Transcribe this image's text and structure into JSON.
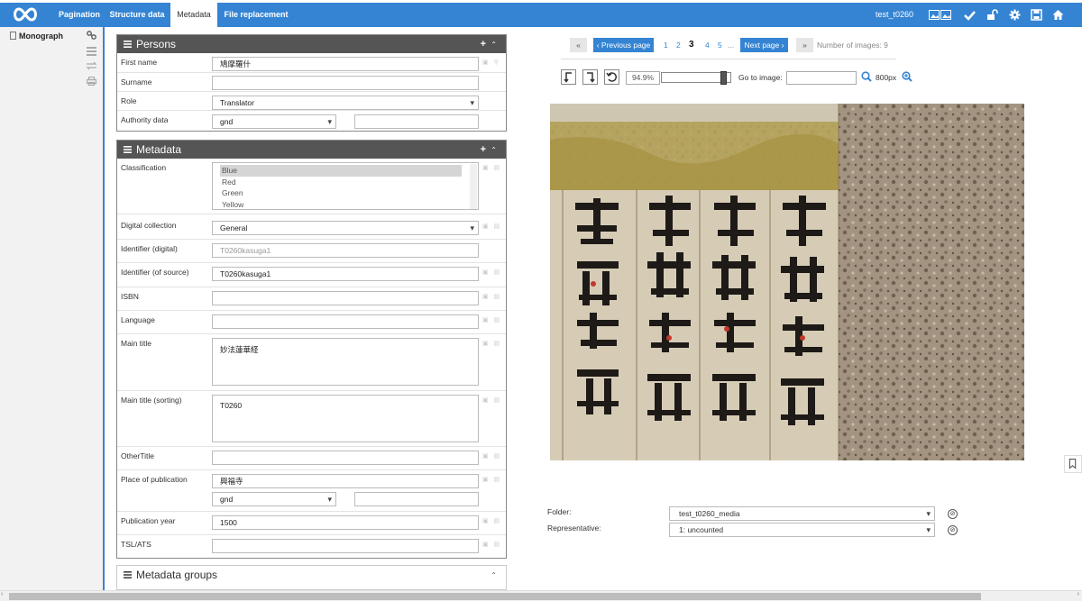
{
  "topbar": {
    "tabs": [
      {
        "label": "Pagination"
      },
      {
        "label": "Structure data"
      },
      {
        "label": "Metadata"
      },
      {
        "label": "File replacement"
      }
    ],
    "process_title": "test_t0260",
    "icons": [
      "images-icon",
      "check-icon",
      "unlock-icon",
      "gear-icon",
      "save-icon",
      "home-icon"
    ],
    "color": "#3484d3"
  },
  "sidebar": {
    "tree_item": "Monograph",
    "tools": [
      "link-icon",
      "list-icon",
      "transfer-icon",
      "print-icon"
    ]
  },
  "persons": {
    "title": "Persons",
    "first_name_label": "First name",
    "first_name_value": "鳩摩羅什",
    "surname_label": "Surname",
    "surname_value": "",
    "role_label": "Role",
    "role_value": "Translator",
    "authority_label": "Authority data",
    "authority_value": "gnd",
    "authority_id": ""
  },
  "metadata": {
    "title": "Metadata",
    "classification_label": "Classification",
    "classification_options": [
      "Blue",
      "Red",
      "Green",
      "Yellow"
    ],
    "digital_collection_label": "Digital collection",
    "digital_collection_value": "General",
    "identifier_digital_label": "Identifier (digital)",
    "identifier_digital_value": "T0260kasuga1",
    "identifier_source_label": "Identifier (of source)",
    "identifier_source_value": "T0260kasuga1",
    "isbn_label": "ISBN",
    "isbn_value": "",
    "language_label": "Language",
    "language_value": "",
    "main_title_label": "Main title",
    "main_title_value": "妙法蓮華経",
    "main_title_sorting_label": "Main title (sorting)",
    "main_title_sorting_value": "T0260",
    "other_title_label": "OtherTitle",
    "other_title_value": "",
    "place_label": "Place of publication",
    "place_value": "興福寺",
    "place_authority": "gnd",
    "year_label": "Publication year",
    "year_value": "1500",
    "tsl_label": "TSL/ATS",
    "tsl_value": ""
  },
  "metadata_groups": {
    "title": "Metadata groups"
  },
  "viewer": {
    "first_label": "«",
    "prev_label": "‹ Previous page",
    "pages": [
      "1",
      "2"
    ],
    "current_page": "3",
    "next_pages": [
      "4",
      "5"
    ],
    "ellipsis": "...",
    "next_label": "Next page ›",
    "last_label": "»",
    "num_images": "Number of images: 9",
    "zoom_value": "94.9%",
    "zoom_level": 0.949,
    "go_to_label": "Go to image:",
    "go_to_value": "",
    "size_label": "800px",
    "folder_label": "Folder:",
    "folder_value": "test_t0260_media",
    "representative_label": "Representative:",
    "representative_value": "1: uncounted"
  }
}
